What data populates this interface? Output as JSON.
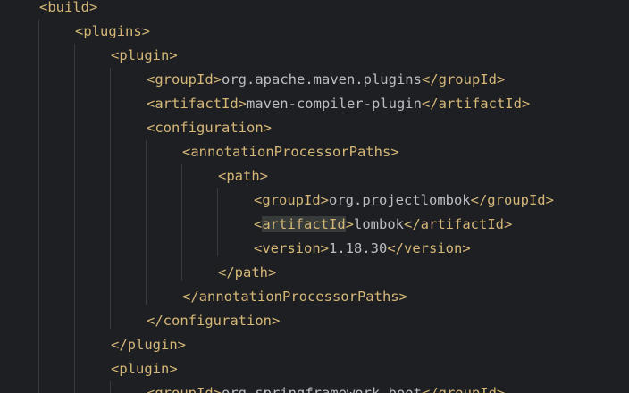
{
  "editor": {
    "lines": [
      {
        "indent": 1,
        "open": "<build>"
      },
      {
        "indent": 2,
        "open": "<plugins>"
      },
      {
        "indent": 3,
        "open": "<plugin>"
      },
      {
        "indent": 4,
        "open": "<groupId>",
        "value": "org.apache.maven.plugins",
        "close": "</groupId>"
      },
      {
        "indent": 4,
        "open": "<artifactId>",
        "value": "maven-compiler-plugin",
        "close": "</artifactId>"
      },
      {
        "indent": 4,
        "open": "<configuration>"
      },
      {
        "indent": 5,
        "open": "<annotationProcessorPaths>"
      },
      {
        "indent": 6,
        "open": "<path>"
      },
      {
        "indent": 7,
        "open": "<groupId>",
        "value": "org.projectlombok",
        "close": "</groupId>"
      },
      {
        "indent": 7,
        "open_pre": "<",
        "open_hl": "artifactId",
        "open_post": ">",
        "value": "lombok",
        "close": "</artifactId>"
      },
      {
        "indent": 7,
        "open": "<version>",
        "value": "1.18.30",
        "close": "</version>"
      },
      {
        "indent": 6,
        "open": "</path>"
      },
      {
        "indent": 5,
        "open": "</annotationProcessorPaths>"
      },
      {
        "indent": 4,
        "open": "</configuration>"
      },
      {
        "indent": 3,
        "open": "</plugin>"
      },
      {
        "indent": 3,
        "open": "<plugin>"
      },
      {
        "indent": 4,
        "open": "<groupId>",
        "value": "org.springframework.boot",
        "close": "</groupId>"
      }
    ]
  }
}
